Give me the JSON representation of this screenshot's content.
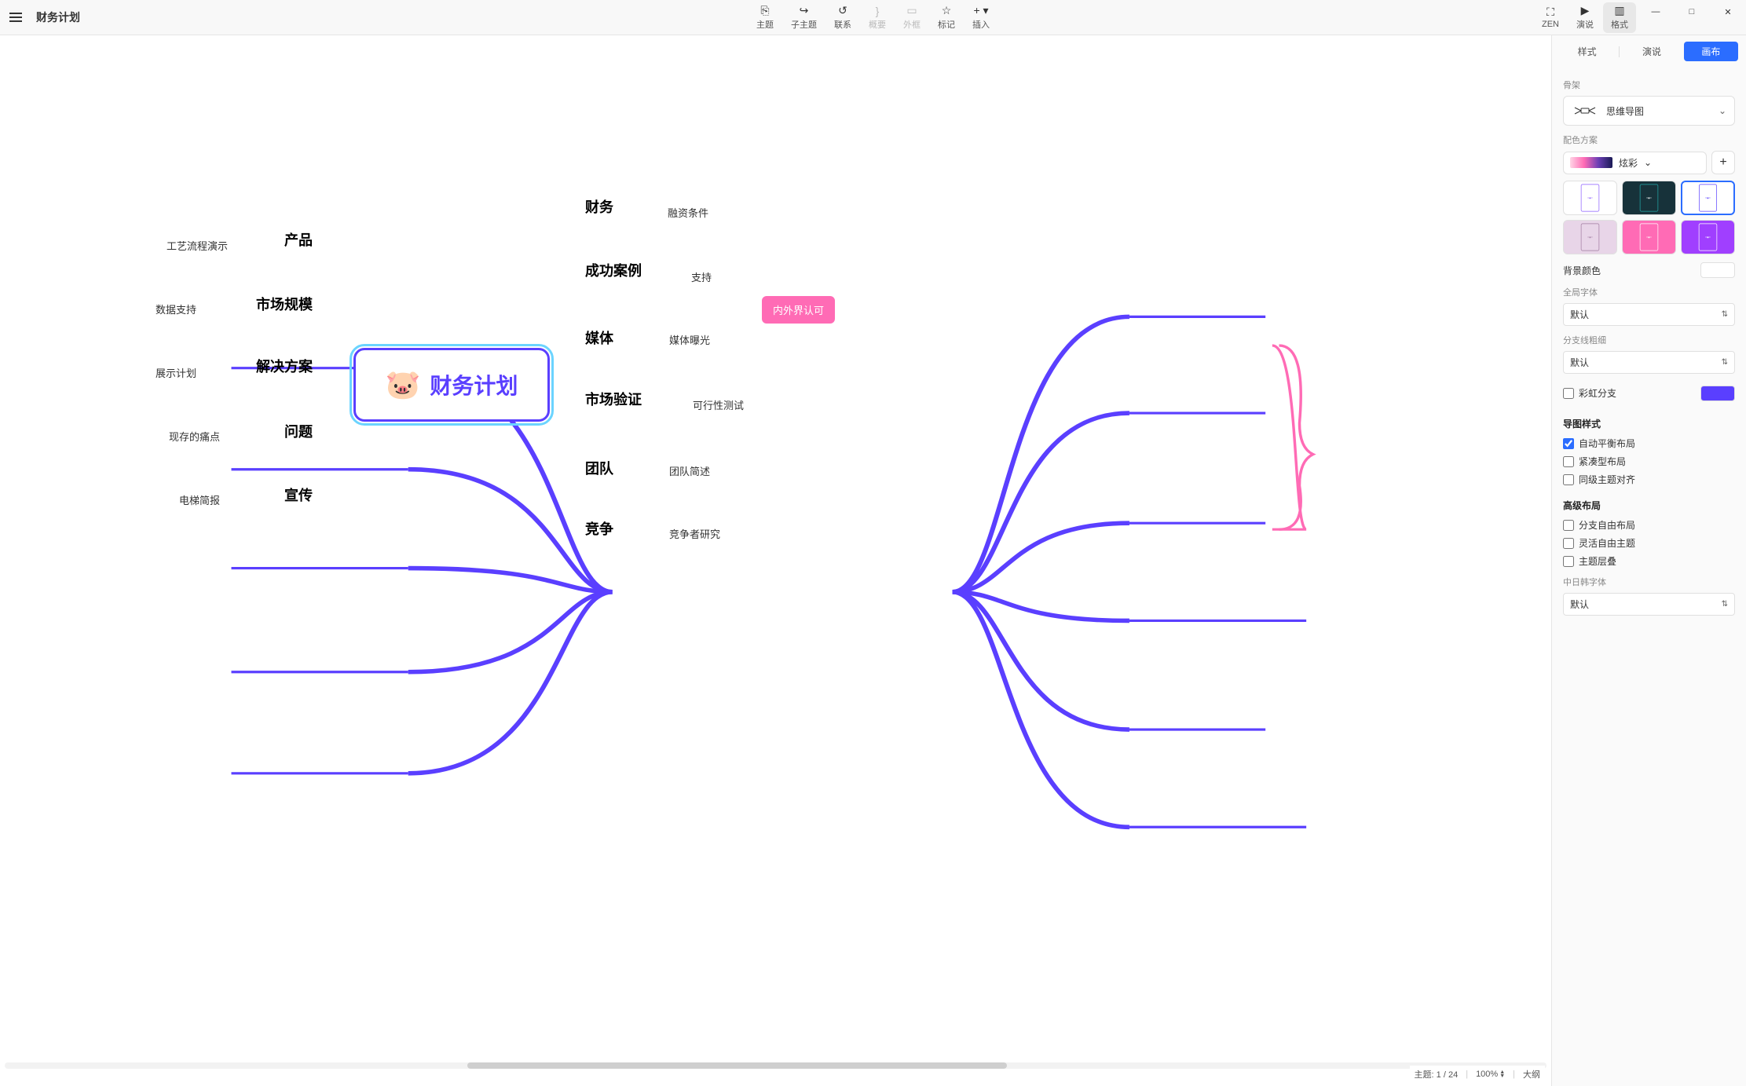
{
  "doc_title": "财务计划",
  "toolbar": {
    "topic": "主题",
    "subtopic": "子主题",
    "relation": "联系",
    "summary": "概要",
    "boundary": "外框",
    "marker": "标记",
    "insert": "插入",
    "zen": "ZEN",
    "present": "演说",
    "format": "格式"
  },
  "mindmap": {
    "central": "财务计划",
    "right": [
      {
        "label": "财务",
        "leaf": "融资条件"
      },
      {
        "label": "成功案例",
        "leaf": "支持"
      },
      {
        "label": "媒体",
        "leaf": "媒体曝光"
      },
      {
        "label": "市场验证",
        "leaf": "可行性测试"
      },
      {
        "label": "团队",
        "leaf": "团队简述"
      },
      {
        "label": "竞争",
        "leaf": "竞争者研究"
      }
    ],
    "left": [
      {
        "label": "产品",
        "leaf": "工艺流程演示"
      },
      {
        "label": "市场规模",
        "leaf": "数据支持"
      },
      {
        "label": "解决方案",
        "leaf": "展示计划"
      },
      {
        "label": "问题",
        "leaf": "现存的痛点"
      },
      {
        "label": "宣传",
        "leaf": "电梯简报"
      }
    ],
    "summary": "内外界认可"
  },
  "panel": {
    "tab_style": "样式",
    "tab_present": "演说",
    "tab_canvas": "画布",
    "skeleton_label": "骨架",
    "skeleton_value": "思维导图",
    "color_scheme_label": "配色方案",
    "color_scheme_value": "炫彩",
    "bg_color_label": "背景颜色",
    "global_font_label": "全局字体",
    "global_font_value": "默认",
    "branch_width_label": "分支线粗细",
    "branch_width_value": "默认",
    "rainbow_label": "彩虹分支",
    "map_style_title": "导图样式",
    "check_auto_balance": "自动平衡布局",
    "check_compact": "紧凑型布局",
    "check_same_level_align": "同级主题对齐",
    "advanced_title": "高级布局",
    "check_free_branch": "分支自由布局",
    "check_flex_topic": "灵活自由主题",
    "check_overlap": "主题层叠",
    "cjk_font_label": "中日韩字体",
    "cjk_font_value": "默认"
  },
  "status": {
    "topics_label": "主题:",
    "topics_value": "1 / 24",
    "zoom": "100%",
    "outline": "大纲"
  }
}
